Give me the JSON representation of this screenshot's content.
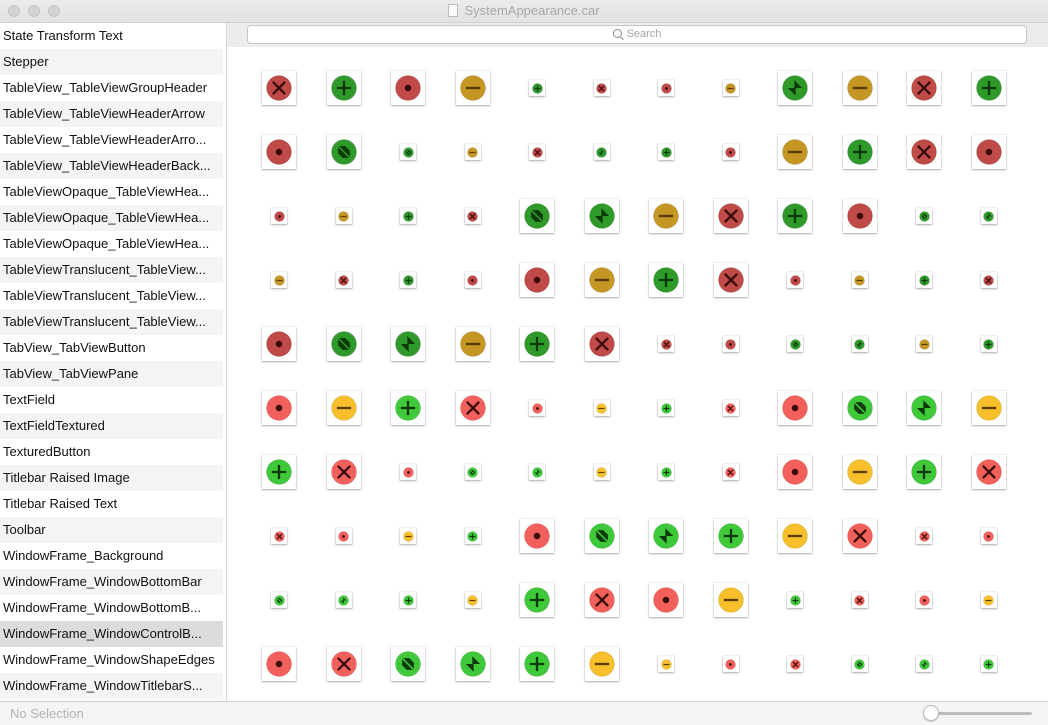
{
  "window": {
    "title": "SystemAppearance.car",
    "controls": [
      "close",
      "minimize",
      "zoom"
    ]
  },
  "sidebar": {
    "selected_index": 23,
    "items": [
      "State Transform Text",
      "Stepper",
      "TableView_TableViewGroupHeader",
      "TableView_TableViewHeaderArrow",
      "TableView_TableViewHeaderArro...",
      "TableView_TableViewHeaderBack...",
      "TableViewOpaque_TableViewHea...",
      "TableViewOpaque_TableViewHea...",
      "TableViewOpaque_TableViewHea...",
      "TableViewTranslucent_TableView...",
      "TableViewTranslucent_TableView...",
      "TableViewTranslucent_TableView...",
      "TabView_TabViewButton",
      "TabView_TabViewPane",
      "TextField",
      "TextFieldTextured",
      "TexturedButton",
      "Titlebar Raised Image",
      "Titlebar Raised Text",
      "Toolbar",
      "WindowFrame_Background",
      "WindowFrame_WindowBottomBar",
      "WindowFrame_WindowBottomB...",
      "WindowFrame_WindowControlB...",
      "WindowFrame_WindowShapeEdges",
      "WindowFrame_WindowTitlebarS..."
    ]
  },
  "search": {
    "placeholder": "Search",
    "value": ""
  },
  "palette": {
    "red": "#bf4a48",
    "green": "#2f9a2a",
    "yellow": "#c49624",
    "red_bright": "#f2605c",
    "green_bright": "#3fc83a",
    "yellow_bright": "#f7c02c",
    "glyph_dark": "#3a0a08",
    "glyph_green": "#0c3a0a",
    "glyph_yellow": "#5a3d05"
  },
  "asset_grid": {
    "columns": 12,
    "rows": [
      [
        [
          "close",
          "red",
          "L"
        ],
        [
          "plus",
          "green",
          "L"
        ],
        [
          "dot",
          "red",
          "L"
        ],
        [
          "minus",
          "yellow",
          "L"
        ],
        [
          "plus",
          "green",
          "S"
        ],
        [
          "close",
          "red",
          "S"
        ],
        [
          "dot",
          "red",
          "S"
        ],
        [
          "minus",
          "yellow",
          "S"
        ],
        [
          "fullscreen",
          "green",
          "L"
        ],
        [
          "minus",
          "yellow",
          "L"
        ],
        [
          "close",
          "red",
          "L"
        ],
        [
          "plus",
          "green",
          "L"
        ]
      ],
      [
        [
          "dot",
          "red",
          "L"
        ],
        [
          "zoom",
          "green",
          "L"
        ],
        [
          "zoom",
          "green",
          "S"
        ],
        [
          "minus",
          "yellow",
          "S"
        ],
        [
          "close",
          "red",
          "S"
        ],
        [
          "fullscreen",
          "green",
          "S"
        ],
        [
          "plus",
          "green",
          "S"
        ],
        [
          "dot",
          "red",
          "S"
        ],
        [
          "minus",
          "yellow",
          "L"
        ],
        [
          "plus",
          "green",
          "L"
        ],
        [
          "close",
          "red",
          "L"
        ],
        [
          "dot",
          "red",
          "L"
        ]
      ],
      [
        [
          "dot",
          "red",
          "S"
        ],
        [
          "minus",
          "yellow",
          "S"
        ],
        [
          "plus",
          "green",
          "S"
        ],
        [
          "close",
          "red",
          "S"
        ],
        [
          "zoom",
          "green",
          "L"
        ],
        [
          "fullscreen",
          "green",
          "L"
        ],
        [
          "minus",
          "yellow",
          "L"
        ],
        [
          "close",
          "red",
          "L"
        ],
        [
          "plus",
          "green",
          "L"
        ],
        [
          "dot",
          "red",
          "L"
        ],
        [
          "zoom",
          "green",
          "S"
        ],
        [
          "fullscreen",
          "green",
          "S"
        ]
      ],
      [
        [
          "minus",
          "yellow",
          "S"
        ],
        [
          "close",
          "red",
          "S"
        ],
        [
          "plus",
          "green",
          "S"
        ],
        [
          "dot",
          "red",
          "S"
        ],
        [
          "dot",
          "red",
          "L"
        ],
        [
          "minus",
          "yellow",
          "L"
        ],
        [
          "plus",
          "green",
          "L"
        ],
        [
          "close",
          "red",
          "L"
        ],
        [
          "dot",
          "red",
          "S"
        ],
        [
          "minus",
          "yellow",
          "S"
        ],
        [
          "plus",
          "green",
          "S"
        ],
        [
          "close",
          "red",
          "S"
        ]
      ],
      [
        [
          "dot",
          "red",
          "L"
        ],
        [
          "zoom",
          "green",
          "L"
        ],
        [
          "fullscreen",
          "green",
          "L"
        ],
        [
          "minus",
          "yellow",
          "L"
        ],
        [
          "plus",
          "green",
          "L"
        ],
        [
          "close",
          "red",
          "L"
        ],
        [
          "close",
          "red",
          "S"
        ],
        [
          "dot",
          "red",
          "S"
        ],
        [
          "zoom",
          "green",
          "S"
        ],
        [
          "fullscreen",
          "green",
          "S"
        ],
        [
          "minus",
          "yellow",
          "S"
        ],
        [
          "plus",
          "green",
          "S"
        ]
      ],
      [
        [
          "dot",
          "red_bright",
          "L"
        ],
        [
          "minus",
          "yellow_bright",
          "L"
        ],
        [
          "plus",
          "green_bright",
          "L"
        ],
        [
          "close",
          "red_bright",
          "L"
        ],
        [
          "dot",
          "red_bright",
          "S"
        ],
        [
          "minus",
          "yellow_bright",
          "S"
        ],
        [
          "plus",
          "green_bright",
          "S"
        ],
        [
          "close",
          "red_bright",
          "S"
        ],
        [
          "dot",
          "red_bright",
          "L"
        ],
        [
          "zoom",
          "green_bright",
          "L"
        ],
        [
          "fullscreen",
          "green_bright",
          "L"
        ],
        [
          "minus",
          "yellow_bright",
          "L"
        ]
      ],
      [
        [
          "plus",
          "green_bright",
          "L"
        ],
        [
          "close",
          "red_bright",
          "L"
        ],
        [
          "dot",
          "red_bright",
          "S"
        ],
        [
          "zoom",
          "green_bright",
          "S"
        ],
        [
          "fullscreen",
          "green_bright",
          "S"
        ],
        [
          "minus",
          "yellow_bright",
          "S"
        ],
        [
          "plus",
          "green_bright",
          "S"
        ],
        [
          "close",
          "red_bright",
          "S"
        ],
        [
          "dot",
          "red_bright",
          "L"
        ],
        [
          "minus",
          "yellow_bright",
          "L"
        ],
        [
          "plus",
          "green_bright",
          "L"
        ],
        [
          "close",
          "red_bright",
          "L"
        ]
      ],
      [
        [
          "close",
          "red_bright",
          "S"
        ],
        [
          "dot",
          "red_bright",
          "S"
        ],
        [
          "minus",
          "yellow_bright",
          "S"
        ],
        [
          "plus",
          "green_bright",
          "S"
        ],
        [
          "dot",
          "red_bright",
          "L"
        ],
        [
          "zoom",
          "green_bright",
          "L"
        ],
        [
          "fullscreen",
          "green_bright",
          "L"
        ],
        [
          "plus",
          "green_bright",
          "L"
        ],
        [
          "minus",
          "yellow_bright",
          "L"
        ],
        [
          "close",
          "red_bright",
          "L"
        ],
        [
          "close",
          "red_bright",
          "S"
        ],
        [
          "dot",
          "red_bright",
          "S"
        ]
      ],
      [
        [
          "zoom",
          "green_bright",
          "S"
        ],
        [
          "fullscreen",
          "green_bright",
          "S"
        ],
        [
          "plus",
          "green_bright",
          "S"
        ],
        [
          "minus",
          "yellow_bright",
          "S"
        ],
        [
          "plus",
          "green_bright",
          "L"
        ],
        [
          "close",
          "red_bright",
          "L"
        ],
        [
          "dot",
          "red_bright",
          "L"
        ],
        [
          "minus",
          "yellow_bright",
          "L"
        ],
        [
          "plus",
          "green_bright",
          "S"
        ],
        [
          "close",
          "red_bright",
          "S"
        ],
        [
          "dot",
          "red_bright",
          "S"
        ],
        [
          "minus",
          "yellow_bright",
          "S"
        ]
      ],
      [
        [
          "dot",
          "red_bright",
          "L"
        ],
        [
          "close",
          "red_bright",
          "L"
        ],
        [
          "zoom",
          "green_bright",
          "L"
        ],
        [
          "fullscreen",
          "green_bright",
          "L"
        ],
        [
          "plus",
          "green_bright",
          "L"
        ],
        [
          "minus",
          "yellow_bright",
          "L"
        ],
        [
          "minus",
          "yellow_bright",
          "S"
        ],
        [
          "dot",
          "red_bright",
          "S"
        ],
        [
          "close",
          "red_bright",
          "S"
        ],
        [
          "zoom",
          "green_bright",
          "S"
        ],
        [
          "fullscreen",
          "green_bright",
          "S"
        ],
        [
          "plus",
          "green_bright",
          "S"
        ]
      ]
    ]
  },
  "statusbar": {
    "text": "No Selection",
    "zoom_slider_value": 0
  }
}
